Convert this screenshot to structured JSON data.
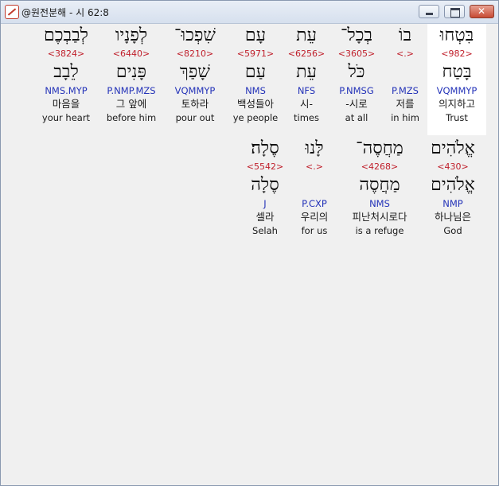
{
  "window": {
    "title": "@원전분해 - 시 62:8"
  },
  "rows": [
    {
      "words": [
        {
          "heb": "בִּטְחוּ",
          "strong": "<982>",
          "lemma": "בָּטַח",
          "morph": "VQMMYP",
          "kor": "의지하고",
          "eng": "Trust"
        },
        {
          "heb": "בוֹ",
          "strong": "<.>",
          "lemma": "",
          "morph": "P.MZS",
          "kor": "저를",
          "eng": "in him"
        },
        {
          "heb": "בְכָל־",
          "strong": "<3605>",
          "lemma": "כֹּל",
          "morph": "P.NMSG",
          "kor": "-시로",
          "eng": "at all"
        },
        {
          "heb": "עֵת",
          "strong": "<6256>",
          "lemma": "עֵת",
          "morph": "NFS",
          "kor": "시-",
          "eng": "times"
        },
        {
          "heb": "עָם",
          "strong": "<5971>",
          "lemma": "עַם",
          "morph": "NMS",
          "kor": "백성들아",
          "eng": "ye people"
        },
        {
          "heb": "שִׁפְכוּ־",
          "strong": "<8210>",
          "lemma": "שָׁפַךְ",
          "morph": "VQMMYP",
          "kor": "토하라",
          "eng": "pour out"
        },
        {
          "heb": "לְפָנָיו",
          "strong": "<6440>",
          "lemma": "פָּנִים",
          "morph": "P.NMP.MZS",
          "kor": "그 앞에",
          "eng": "before him"
        },
        {
          "heb": "לְבַבְכֶם",
          "strong": "<3824>",
          "lemma": "לֵבָב",
          "morph": "NMS.MYP",
          "kor": "마음을",
          "eng": "your heart"
        }
      ]
    },
    {
      "words": [
        {
          "heb": "אֱלֹהִים",
          "strong": "<430>",
          "lemma": "אֱלֹהִים",
          "morph": "NMP",
          "kor": "하나님은",
          "eng": "God"
        },
        {
          "heb": "מַחֲסֶה־",
          "strong": "<4268>",
          "lemma": "מַחֲסֶה",
          "morph": "NMS",
          "kor": "피난처시로다",
          "eng": "is a refuge"
        },
        {
          "heb": "לָּנוּ",
          "strong": "<.>",
          "lemma": "",
          "morph": "P.CXP",
          "kor": "우리의",
          "eng": "for us"
        },
        {
          "heb": "סֶלָה׃",
          "strong": "<5542>",
          "lemma": "סֶלָה",
          "morph": "J",
          "kor": "셀라",
          "eng": "Selah"
        }
      ]
    }
  ]
}
